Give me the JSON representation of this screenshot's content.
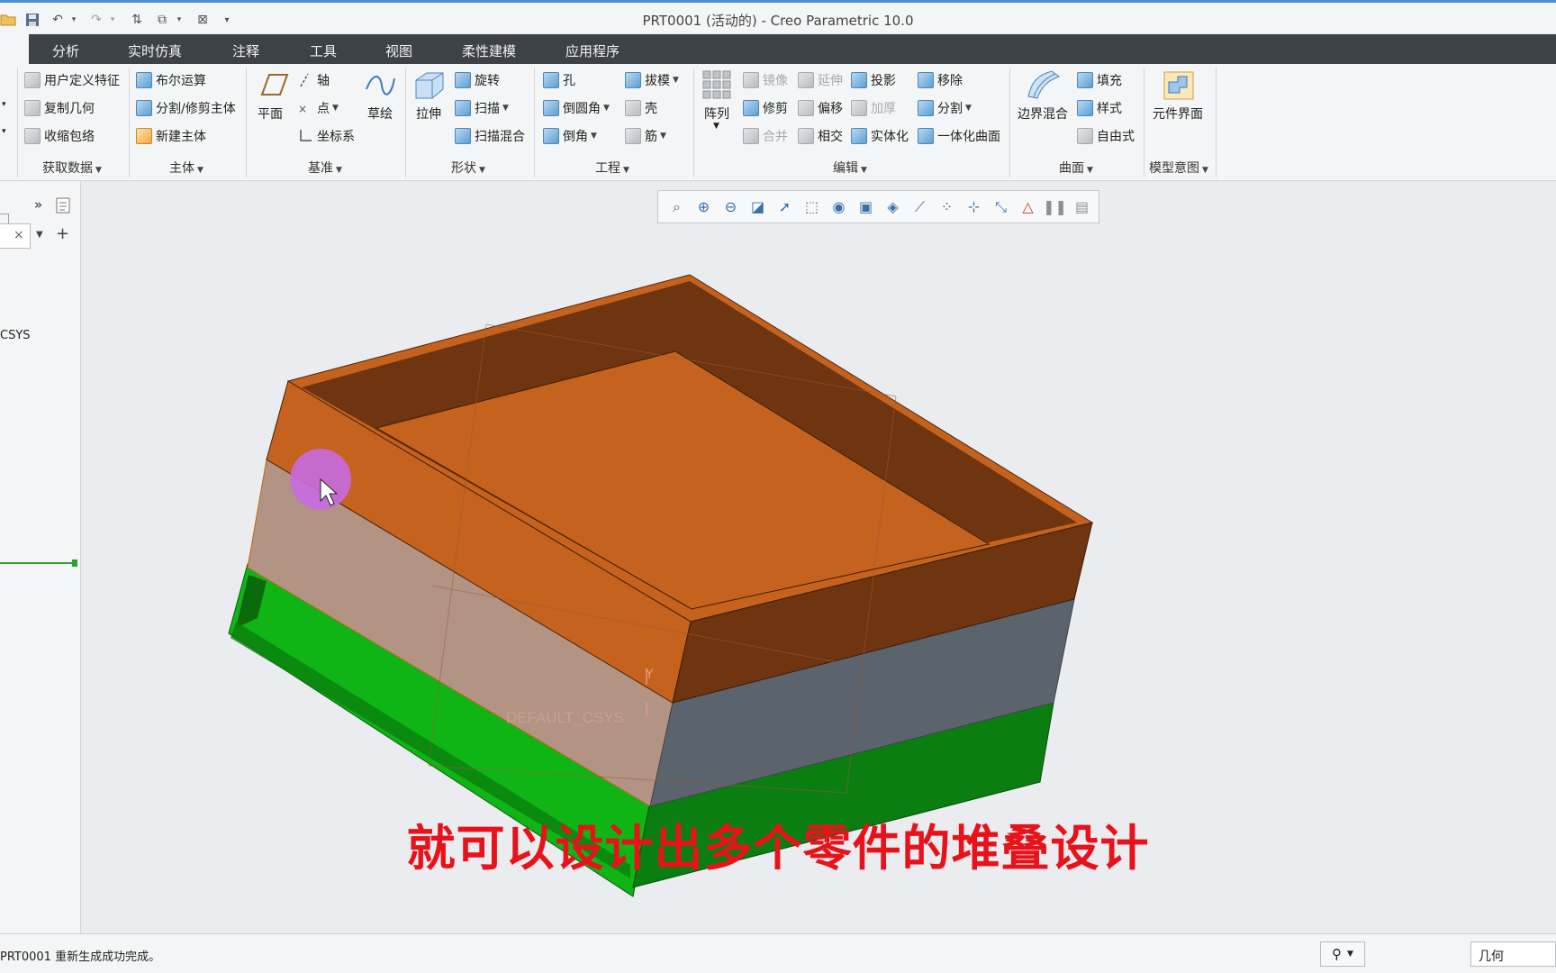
{
  "window": {
    "title": "PRT0001 (活动的) - Creo Parametric 10.0"
  },
  "quick_access": [
    {
      "name": "open-icon",
      "glyph": "📂"
    },
    {
      "name": "save-icon",
      "glyph": "💾"
    },
    {
      "name": "undo-icon",
      "glyph": "↶"
    },
    {
      "name": "redo-icon",
      "glyph": "↷"
    },
    {
      "name": "regenerate-icon",
      "glyph": "⇅"
    },
    {
      "name": "windows-icon",
      "glyph": "⧉"
    },
    {
      "name": "close-window-icon",
      "glyph": "⊠"
    },
    {
      "name": "customize-icon",
      "glyph": "▾"
    }
  ],
  "menu": {
    "items": [
      "分析",
      "实时仿真",
      "注释",
      "工具",
      "视图",
      "柔性建模",
      "应用程序"
    ]
  },
  "ribbon": {
    "get_data": {
      "items": [
        "用户定义特征",
        "复制几何",
        "收缩包络"
      ],
      "label": "获取数据"
    },
    "body": {
      "items": [
        "布尔运算",
        "分割/修剪主体",
        "新建主体"
      ],
      "label": "主体"
    },
    "datum": {
      "plane": "平面",
      "axis": "轴",
      "point": "点",
      "csys": "坐标系",
      "sketch": "草绘",
      "label": "基准"
    },
    "shapes": {
      "extrude": "拉伸",
      "revolve": "旋转",
      "sweep": "扫描",
      "swept_blend": "扫描混合",
      "label": "形状"
    },
    "engineering": {
      "hole": "孔",
      "draft": "拔模",
      "round": "倒圆角",
      "shell": "壳",
      "chamfer": "倒角",
      "rib": "筋",
      "label": "工程"
    },
    "editing": {
      "pattern": "阵列",
      "mirror": "镜像",
      "extend": "延伸",
      "project": "投影",
      "move": "移除",
      "trim": "修剪",
      "offset": "偏移",
      "thicken": "加厚",
      "split": "分割",
      "merge": "合并",
      "intersect": "相交",
      "solidify": "实体化",
      "unify": "一体化曲面",
      "label": "编辑"
    },
    "surfaces": {
      "boundary_blend": "边界混合",
      "fill": "填充",
      "style": "样式",
      "freestyle": "自由式",
      "label": "曲面"
    },
    "model_intent": {
      "component_interface": "元件界面",
      "label": "模型意图"
    }
  },
  "left_panel": {
    "csys_label": "CSYS"
  },
  "view_toolbar": {
    "icons": [
      "refit-icon",
      "zoom-in-icon",
      "zoom-out-icon",
      "repaint-icon",
      "orient-icon",
      "saved-orientations-icon",
      "display-style-icon",
      "view-manager-icon",
      "section-icon",
      "datum-display-icon",
      "annotation-display-icon",
      "spin-center-icon",
      "csys-display-icon",
      "appearance-icon",
      "pause-icon",
      "feature-display-icon"
    ]
  },
  "model": {
    "csys_label": "DEFAULT_CSYS",
    "axis_y": "Y",
    "colors": {
      "orange": "#c4621e",
      "dark_orange": "#6e3510",
      "green": "#13b81a",
      "dark_green": "#0b7d10",
      "slate": "#5b636c"
    }
  },
  "subtitle": "就可以设计出多个零件的堆叠设计",
  "status": {
    "message": "PRT0001 重新生成成功完成。",
    "filter": "几何"
  }
}
